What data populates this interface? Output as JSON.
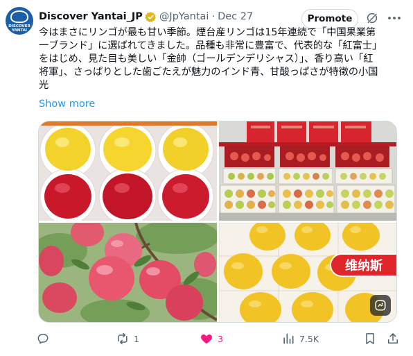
{
  "tweet": {
    "display_name": "Discover Yantai_JP",
    "handle": "@JpYantai",
    "separator": "·",
    "date": "Dec 27",
    "promote_label": "Promote",
    "avatar_text": [
      "DISCOVER",
      "YANTAI"
    ],
    "body_lines": [
      "今はまさにリンゴが最も甘い季節。煙台産リンゴは15年連続で「中国果業第",
      "一ブランド」に選ばれてきました。品種も非常に豊富で、代表的な「紅富士」",
      "をはじめ、見た目も美しい「金帥（ゴールデンデリシャス）」、香り高い「紅",
      "将軍」、さっぱりとした歯ごたえが魅力のインド青、甘酸っぱさが特徴の小国",
      "光"
    ],
    "show_more": "Show more",
    "media_badge": "维纳斯"
  },
  "actions": {
    "reply_count": "",
    "retweet_count": "1",
    "like_count": "3",
    "view_count": "7.5K"
  },
  "colors": {
    "accent_blue": "#1d9bf0",
    "like_pink": "#f91880",
    "verified_gold": "#e2b719",
    "muted": "#536471"
  },
  "icons": [
    "verified-badge-icon",
    "grok-icon",
    "more-icon",
    "reply-icon",
    "retweet-icon",
    "like-icon",
    "views-icon",
    "bookmark-icon",
    "share-icon",
    "alt-text-icon"
  ]
}
